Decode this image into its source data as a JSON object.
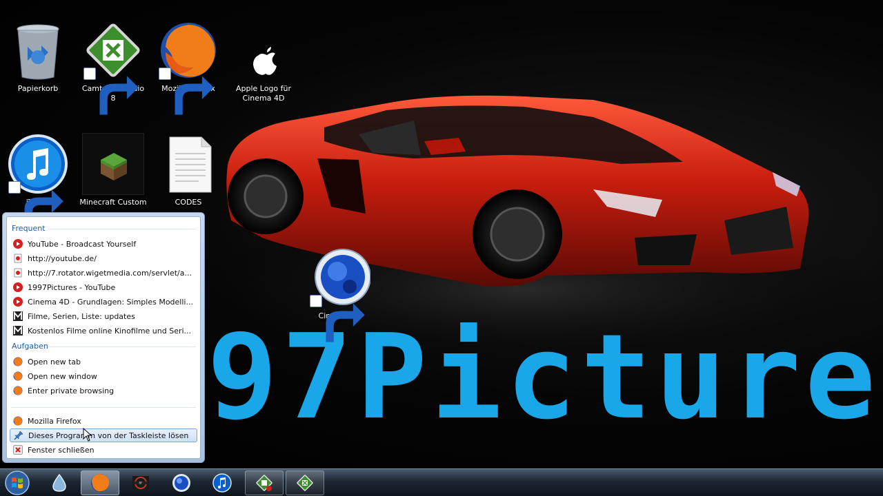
{
  "wallpaper": {
    "brand_text": "97Picture",
    "brand_color": "#19a7ea",
    "car_color": "#c81d0e"
  },
  "desktop_icons": [
    {
      "label": "Papierkorb",
      "icon": "recycle-bin-icon"
    },
    {
      "label": "Camtasia Studio 8",
      "icon": "camtasia-icon"
    },
    {
      "label": "Mozilla Firefox",
      "icon": "firefox-icon"
    },
    {
      "label": "Apple Logo für Cinema 4D",
      "icon": "apple-logo-icon"
    },
    {
      "label": "iTunes",
      "icon": "itunes-icon"
    },
    {
      "label": "Minecraft Custom",
      "icon": "minecraft-icon"
    },
    {
      "label": "CODES",
      "icon": "text-file-icon"
    },
    {
      "label": "Cinema 4D",
      "icon": "cinema4d-icon"
    }
  ],
  "jumplist": {
    "frequent_header": "Frequent",
    "frequent": [
      {
        "label": "YouTube - Broadcast Yourself",
        "icon": "youtube-icon"
      },
      {
        "label": "http://youtube.de/",
        "icon": "page-icon"
      },
      {
        "label": "http://7.rotator.wigetmedia.com/servlet/a...",
        "icon": "page-icon"
      },
      {
        "label": "1997Pictures - YouTube",
        "icon": "youtube-icon"
      },
      {
        "label": "Cinema 4D - Grundlagen: Simples Modelli...",
        "icon": "youtube-icon"
      },
      {
        "label": "Filme, Serien, Liste: updates",
        "icon": "m-site-icon"
      },
      {
        "label": "Kostenlos Filme online Kinofilme und Seri...",
        "icon": "m-site-icon"
      }
    ],
    "tasks_header": "Aufgaben",
    "tasks": [
      {
        "label": "Open new tab",
        "icon": "firefox-icon"
      },
      {
        "label": "Open new window",
        "icon": "firefox-icon"
      },
      {
        "label": "Enter private browsing",
        "icon": "firefox-icon"
      }
    ],
    "app_items": [
      {
        "label": "Mozilla Firefox",
        "icon": "firefox-icon"
      },
      {
        "label": "Dieses Programm von der Taskleiste lösen",
        "icon": "unpin-icon"
      },
      {
        "label": "Fenster schließen",
        "icon": "close-icon"
      }
    ]
  },
  "taskbar": {
    "items": [
      {
        "name": "taskbar-start-button",
        "icon": "windows-logo-icon"
      },
      {
        "name": "taskbar-water-app",
        "icon": "droplet-icon"
      },
      {
        "name": "taskbar-firefox",
        "icon": "firefox-icon"
      },
      {
        "name": "taskbar-battlefield",
        "icon": "battlefield-icon"
      },
      {
        "name": "taskbar-cinema4d",
        "icon": "cinema4d-icon"
      },
      {
        "name": "taskbar-itunes",
        "icon": "itunes-icon"
      },
      {
        "name": "taskbar-camtasia-recorder",
        "icon": "camtasia-recorder-icon"
      },
      {
        "name": "taskbar-camtasia",
        "icon": "camtasia-icon"
      }
    ]
  }
}
